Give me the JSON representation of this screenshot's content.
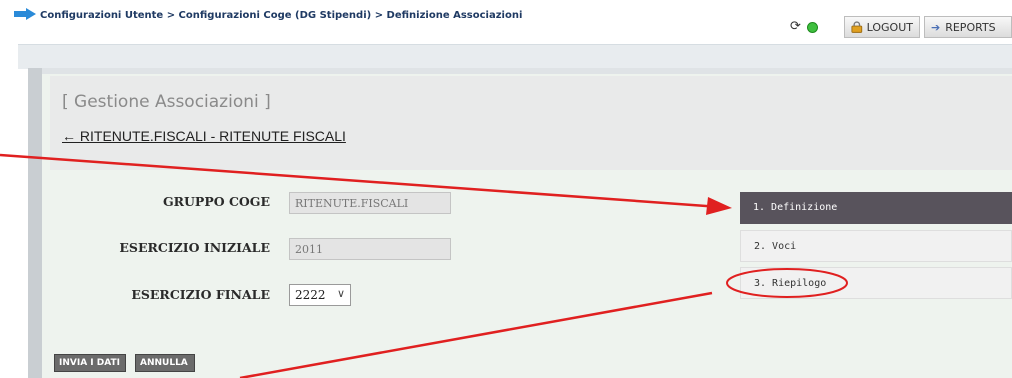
{
  "colors": {
    "accent_red": "#e02020",
    "step_active": "#58535c",
    "nav_arrow": "#2a8ad8"
  },
  "header": {
    "breadcrumb": "Configurazioni Utente > Configurazioni Coge (DG Stipendi) > Definizione Associazioni",
    "logout_label": "LOGOUT",
    "reports_label": "REPORTS",
    "user_link": "",
    "status_icons": [
      "refresh-icon",
      "online-status-icon"
    ]
  },
  "page": {
    "title": "[ Gestione Associazioni ]",
    "back_link": "← RITENUTE.FISCALI - RITENUTE FISCALI"
  },
  "form": {
    "gruppo_label": "GRUPPO COGE",
    "gruppo_value": "RITENUTE.FISCALI",
    "esercizio_iniziale_label": "ESERCIZIO INIZIALE",
    "esercizio_iniziale_value": "2011",
    "esercizio_finale_label": "ESERCIZIO FINALE",
    "esercizio_finale_value": "2222"
  },
  "steps": [
    {
      "label": "1. Definizione",
      "active": true
    },
    {
      "label": "2. Voci",
      "active": false
    },
    {
      "label": "3. Riepilogo",
      "active": false
    }
  ],
  "actions": {
    "send_label": "INVIA I DATI",
    "cancel_label": "ANNULLA"
  }
}
